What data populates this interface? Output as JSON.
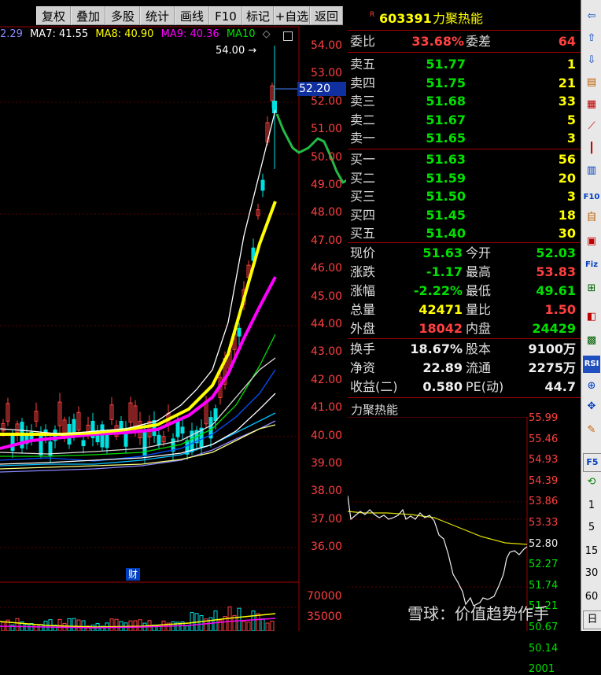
{
  "toolbar": {
    "items": [
      "复权",
      "叠加",
      "多股",
      "统计",
      "画线",
      "F10",
      "标记",
      "+自选",
      "返回"
    ]
  },
  "ma_legend": {
    "ma5": "2.29",
    "ma7": "MA7: 41.55",
    "ma8": "MA8: 40.90",
    "ma9": "MA9: 40.36",
    "ma10": "MA10"
  },
  "kline": {
    "high_marker": "54.00",
    "current_price_tag": "52.20",
    "finance_marker": "财",
    "price_axis": [
      "54.00",
      "53.00",
      "52.00",
      "51.00",
      "50.00",
      "49.00",
      "48.00",
      "47.00",
      "46.00",
      "45.00",
      "44.00",
      "43.00",
      "42.00",
      "41.00",
      "40.00",
      "39.00",
      "38.00",
      "37.00",
      "36.00"
    ],
    "volume_axis": [
      "70000",
      "35000"
    ]
  },
  "quote": {
    "code": "603391",
    "name": "力聚热能",
    "r_badge": "R",
    "weibi_label": "委比",
    "weibi_value": "33.68%",
    "weicha_label": "委差",
    "weicha_value": "64",
    "asks": [
      {
        "label": "卖五",
        "price": "51.77",
        "vol": "1"
      },
      {
        "label": "卖四",
        "price": "51.75",
        "vol": "21"
      },
      {
        "label": "卖三",
        "price": "51.68",
        "vol": "33"
      },
      {
        "label": "卖二",
        "price": "51.67",
        "vol": "5"
      },
      {
        "label": "卖一",
        "price": "51.65",
        "vol": "3"
      }
    ],
    "bids": [
      {
        "label": "买一",
        "price": "51.63",
        "vol": "56"
      },
      {
        "label": "买二",
        "price": "51.59",
        "vol": "20"
      },
      {
        "label": "买三",
        "price": "51.50",
        "vol": "3"
      },
      {
        "label": "买四",
        "price": "51.45",
        "vol": "18"
      },
      {
        "label": "买五",
        "price": "51.40",
        "vol": "30"
      }
    ],
    "stats": [
      {
        "l1": "现价",
        "v1": "51.63",
        "l2": "今开",
        "v2": "52.03"
      },
      {
        "l1": "涨跌",
        "v1": "-1.17",
        "l2": "最高",
        "v2": "53.83"
      },
      {
        "l1": "涨幅",
        "v1": "-2.22%",
        "l2": "最低",
        "v2": "49.61"
      },
      {
        "l1": "总量",
        "v1": "42471",
        "l2": "量比",
        "v2": "1.50"
      },
      {
        "l1": "外盘",
        "v1": "18042",
        "l2": "内盘",
        "v2": "24429"
      }
    ],
    "fund": [
      {
        "l1": "换手",
        "v1": "18.67%",
        "l2": "股本",
        "v2": "9100万"
      },
      {
        "l1": "净资",
        "v1": "22.89",
        "l2": "流通",
        "v2": "2275万"
      },
      {
        "l1": "收益(二)",
        "v1": "0.580",
        "l2": "PE(动)",
        "v2": "44.7"
      }
    ]
  },
  "mini_chart": {
    "title": "力聚热能",
    "prices": [
      "55.99",
      "55.46",
      "54.93",
      "54.39",
      "53.86",
      "53.33",
      "52.80",
      "52.27",
      "51.74",
      "51.21",
      "50.67",
      "50.14",
      "2001"
    ]
  },
  "right_tools": {
    "rsi": "RSI",
    "f5": "F5",
    "nums": [
      "1",
      "5",
      "15",
      "30",
      "60"
    ],
    "day": "日"
  },
  "watermark": "雪球：价值趋势作手",
  "colors": {
    "up": "#ff4040",
    "down": "#00e000",
    "ma5": "#ffffff",
    "ma7": "#ffff00",
    "ma9": "#ff00ff",
    "ma10": "#00e000",
    "background": "#000000"
  }
}
